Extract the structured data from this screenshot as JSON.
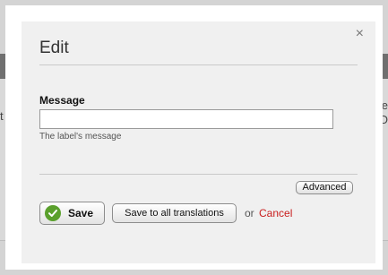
{
  "background": {
    "left_fragment": "t",
    "right_fragment_1": "e",
    "right_fragment_2": "D"
  },
  "dialog": {
    "close_symbol": "×",
    "title": "Edit",
    "field": {
      "label": "Message",
      "value": "",
      "hint": "The label's message"
    },
    "advanced_label": "Advanced",
    "save_label": "Save",
    "save_all_label": "Save to all translations",
    "or_text": "or",
    "cancel_label": "Cancel"
  },
  "colors": {
    "cancel_link": "#c91e1e",
    "check_icon": "#5aa02c"
  },
  "icons": {
    "close": "close-icon",
    "save": "check-circle-icon"
  }
}
